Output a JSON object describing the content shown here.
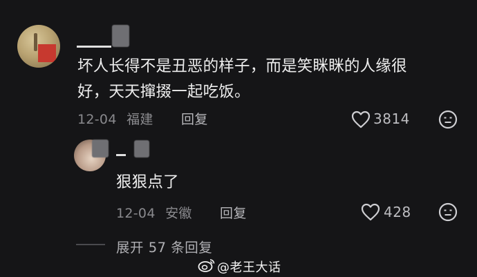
{
  "comment": {
    "text_line1": "坏人长得不是丑恶的样子，而是笑眯眯的人缘很",
    "text_line2": "好，天天撺掇一起吃饭。",
    "date": "12-04",
    "location": "福建",
    "reply_label": "回复",
    "likes": "3814"
  },
  "reply": {
    "text": "狠狠点了",
    "date": "12-04",
    "location": "安徽",
    "reply_label": "回复",
    "likes": "428"
  },
  "expand": {
    "label": "展开 57 条回复"
  },
  "watermark": {
    "text": "@老王大话"
  },
  "icons": {
    "heart": "heart-outline-icon",
    "emoji": "neutral-face-icon",
    "weibo": "weibo-logo-icon"
  },
  "colors": {
    "background": "#151517",
    "text": "#ededed",
    "meta": "#8a8a8e"
  }
}
